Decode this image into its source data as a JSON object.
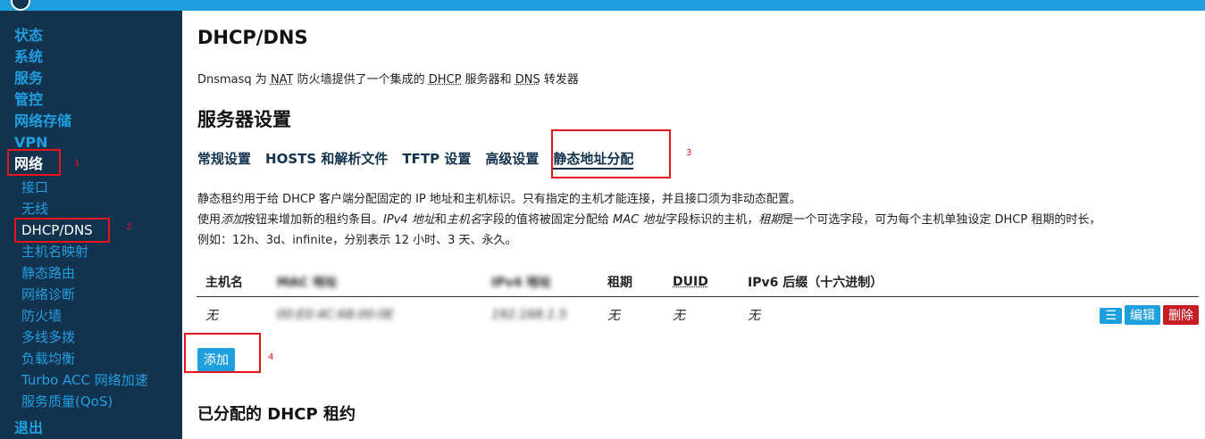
{
  "sidebar": {
    "top_items": [
      "状态",
      "系统",
      "服务",
      "管控",
      "网络存储",
      "VPN",
      "网络"
    ],
    "sub_items": [
      "接口",
      "无线",
      "DHCP/DNS",
      "主机名映射",
      "静态路由",
      "网络诊断",
      "防火墙",
      "多线多拨",
      "负载均衡",
      "Turbo ACC 网络加速",
      "服务质量(QoS)"
    ],
    "logout": "退出"
  },
  "page": {
    "title": "DHCP/DNS",
    "desc_prefix": "Dnsmasq 为 ",
    "desc_nat": "NAT",
    "desc_mid1": " 防火墙提供了一个集成的 ",
    "desc_dhcp": "DHCP",
    "desc_mid2": " 服务器和 ",
    "desc_dns": "DNS",
    "desc_suffix": " 转发器",
    "section_title": "服务器设置",
    "tabs": [
      "常规设置",
      "HOSTS 和解析文件",
      "TFTP 设置",
      "高级设置",
      "静态地址分配"
    ],
    "info_line1": "静态租约用于给 DHCP 客户端分配固定的 IP 地址和主机标识。只有指定的主机才能连接，并且接口须为非动态配置。",
    "info_line2_a": "使用",
    "info_line2_add": "添加",
    "info_line2_b": "按钮来增加新的租约条目。",
    "info_line2_ipv4": "IPv4 地址",
    "info_line2_and": "和",
    "info_line2_host": "主机名",
    "info_line2_c": "字段的值将被固定分配给 ",
    "info_line2_mac": "MAC 地址",
    "info_line2_d": "字段标识的主机，",
    "info_line2_lease": "租期",
    "info_line2_e": "是一个可选字段，可为每个主机单独设定 DHCP 租期的时长，",
    "info_line3": "例如：12h、3d、infinite，分别表示 12 小时、3 天、永久。",
    "table_headers": [
      "主机名",
      "MAC 地址",
      "IPv4 地址",
      "租期",
      "DUID",
      "IPv6 后缀（十六进制）"
    ],
    "row": {
      "hostname": "无",
      "mac": "00:E0:4C:68:00:0E",
      "ipv4": "192.168.1.5",
      "lease": "无",
      "duid": "无",
      "ipv6": "无"
    },
    "row_buttons": {
      "menu": "☰",
      "edit": "编辑",
      "delete": "删除"
    },
    "add_button": "添加",
    "assigned_title": "已分配的 DHCP 租约"
  },
  "annotations": [
    "1",
    "2",
    "3",
    "4"
  ]
}
